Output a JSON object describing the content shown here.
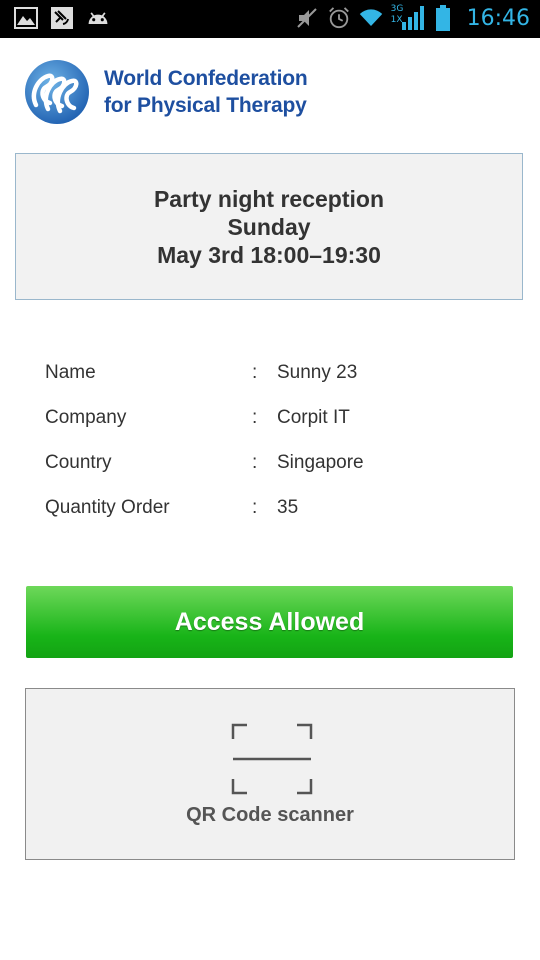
{
  "status_bar": {
    "time": "16:46",
    "left_icons": [
      "image-icon",
      "satellite-icon",
      "android-icon"
    ],
    "right_icons": [
      "mute-icon",
      "alarm-icon",
      "wifi-icon",
      "signal-icon",
      "battery-icon"
    ],
    "network_label_top": "3G",
    "network_label_bottom": "1X",
    "time_color": "#33b5e5"
  },
  "header": {
    "org_line1": "World Confederation",
    "org_line2": "for Physical Therapy",
    "brand_color": "#1e4fa0"
  },
  "event": {
    "title": "Party night reception",
    "day": "Sunday",
    "datetime": "May 3rd 18:00–19:30"
  },
  "details": [
    {
      "label": "Name",
      "separator": ":",
      "value": "Sunny 23"
    },
    {
      "label": "Company",
      "separator": ":",
      "value": "Corpit IT"
    },
    {
      "label": "Country",
      "separator": ":",
      "value": "Singapore"
    },
    {
      "label": "Quantity Order",
      "separator": ":",
      "value": "35"
    }
  ],
  "access": {
    "label": "Access Allowed",
    "color": "#18b418"
  },
  "scanner": {
    "label": "QR Code scanner",
    "icon": "qr-scan-icon"
  }
}
